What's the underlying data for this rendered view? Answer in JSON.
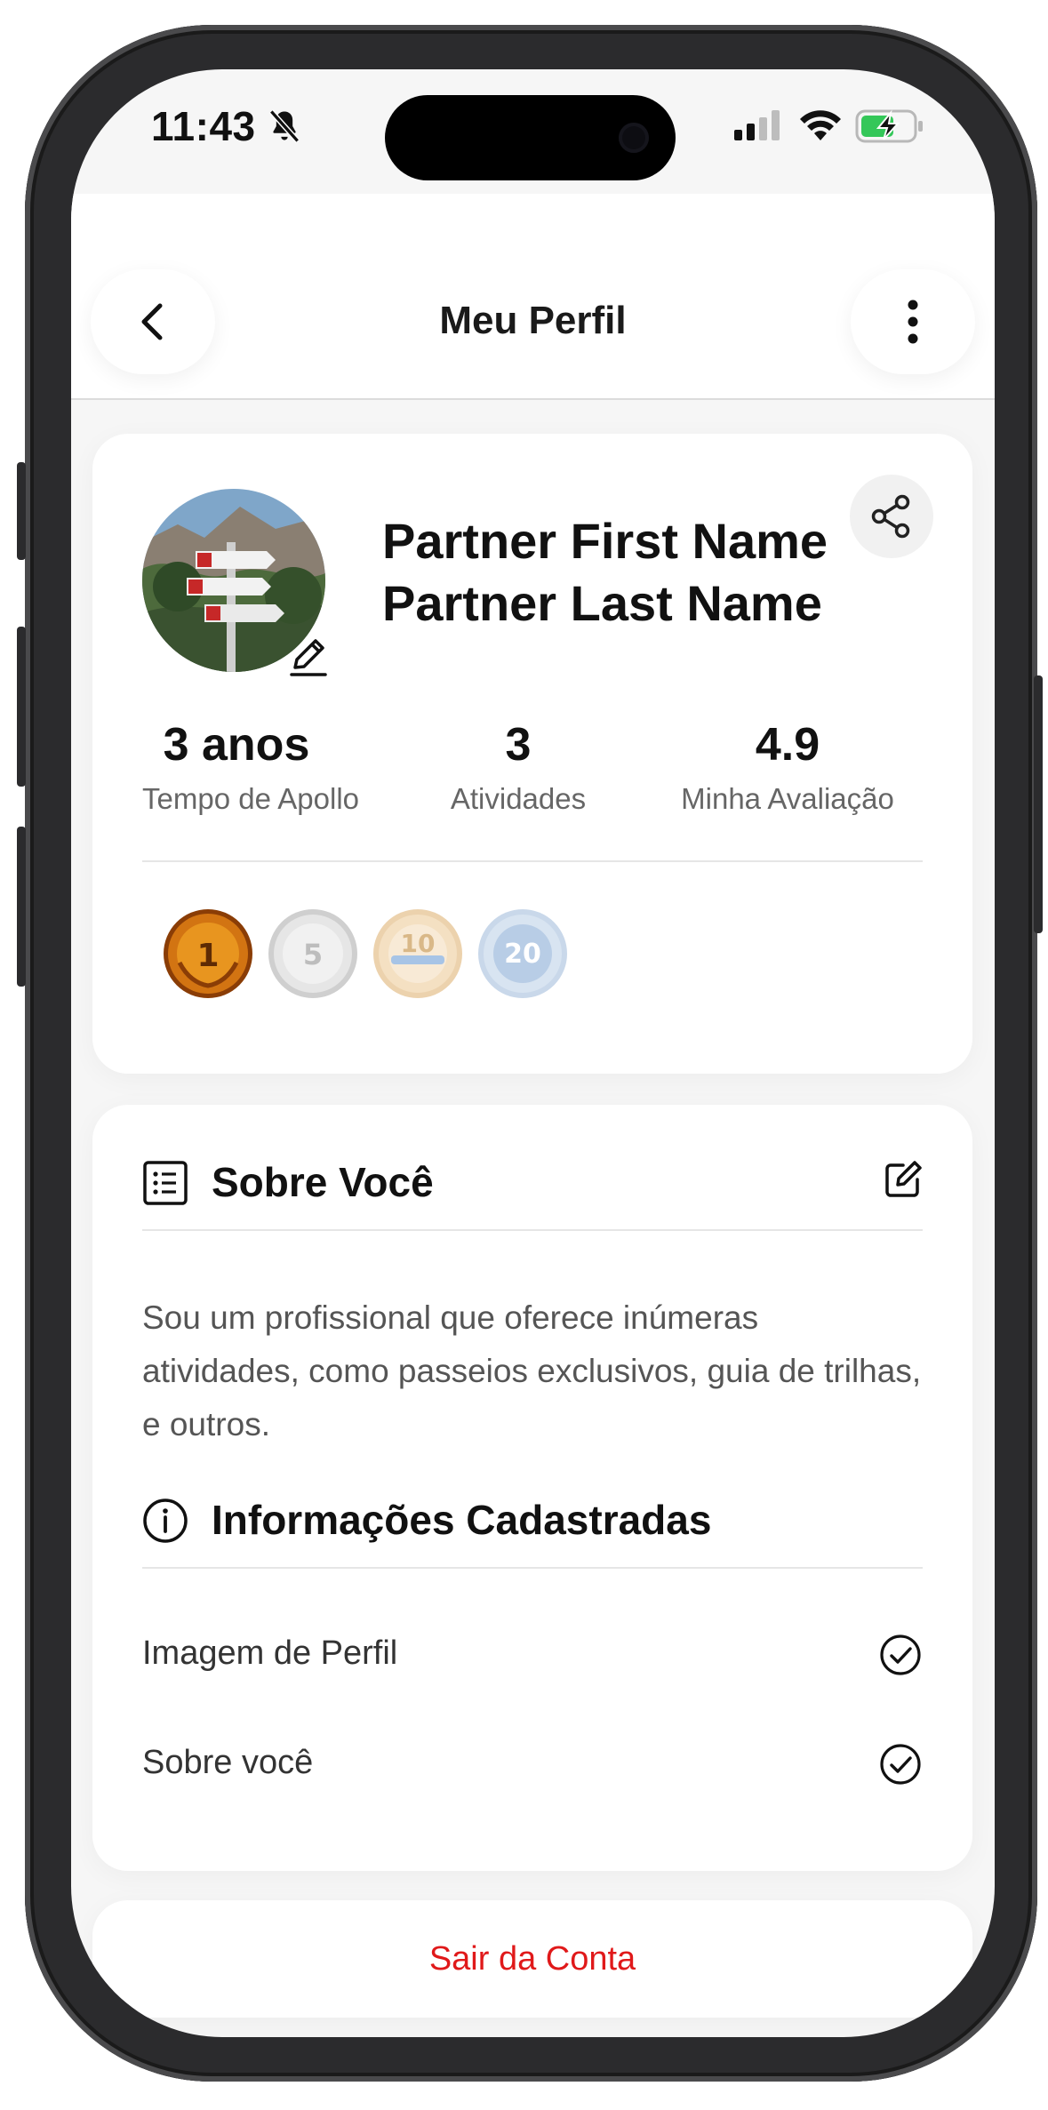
{
  "status_bar": {
    "time": "11:43",
    "icons": [
      "bell-slash-icon",
      "cellular-signal-icon",
      "wifi-icon",
      "battery-charging-icon"
    ]
  },
  "header": {
    "title": "Meu Perfil",
    "back_icon": "chevron-left-icon",
    "more_icon": "vertical-ellipsis-icon"
  },
  "profile": {
    "first_name": "Partner First Name",
    "last_name": "Partner Last Name",
    "avatar_icon": "profile-photo",
    "edit_icon": "pencil-icon",
    "share_icon": "share-icon",
    "stats": [
      {
        "value": "3 anos",
        "label": "Tempo de Apollo"
      },
      {
        "value": "3",
        "label": "Atividades"
      },
      {
        "value": "4.9",
        "label": "Minha Avaliação"
      }
    ],
    "medals": [
      {
        "name": "medal-1",
        "active": true
      },
      {
        "name": "medal-5",
        "active": false
      },
      {
        "name": "medal-10",
        "active": false
      },
      {
        "name": "medal-20",
        "active": false
      }
    ]
  },
  "about": {
    "title": "Sobre Você",
    "text": "Sou um profissional que oferece inúmeras atividades, como passeios exclusivos, guia de trilhas, e outros.",
    "icon": "list-document-icon",
    "edit_icon": "edit-square-icon"
  },
  "info": {
    "title": "Informações Cadastradas",
    "icon": "info-circle-icon",
    "items": [
      {
        "label": "Imagem de Perfil",
        "checked": true
      },
      {
        "label": "Sobre você",
        "checked": true
      }
    ]
  },
  "logout": {
    "label": "Sair da Conta",
    "color": "#e0191a"
  }
}
